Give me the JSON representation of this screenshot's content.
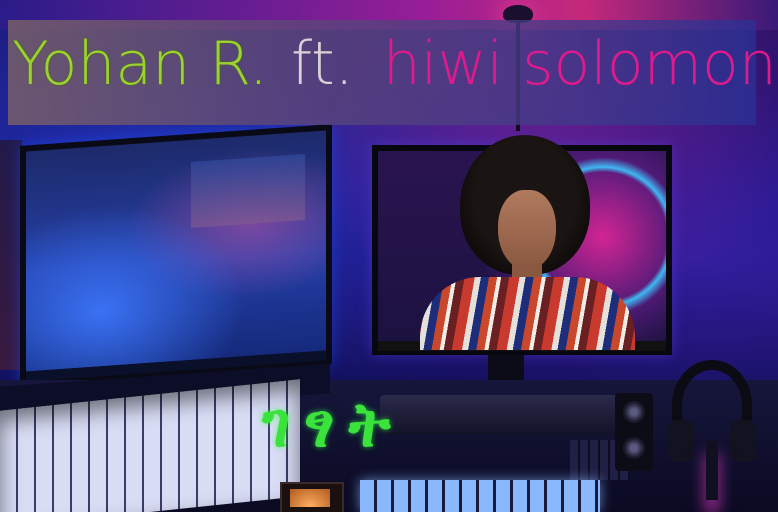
{
  "title": {
    "artist": "Yohan R.",
    "feat": "ft.",
    "featured_artist": "hiwi solomon"
  },
  "song_title": "ገፃት",
  "colors": {
    "artist": "#9ad32e",
    "feat": "#d8d3d6",
    "featured_artist": "#e01a8c",
    "song_title": "#3ce23c"
  }
}
